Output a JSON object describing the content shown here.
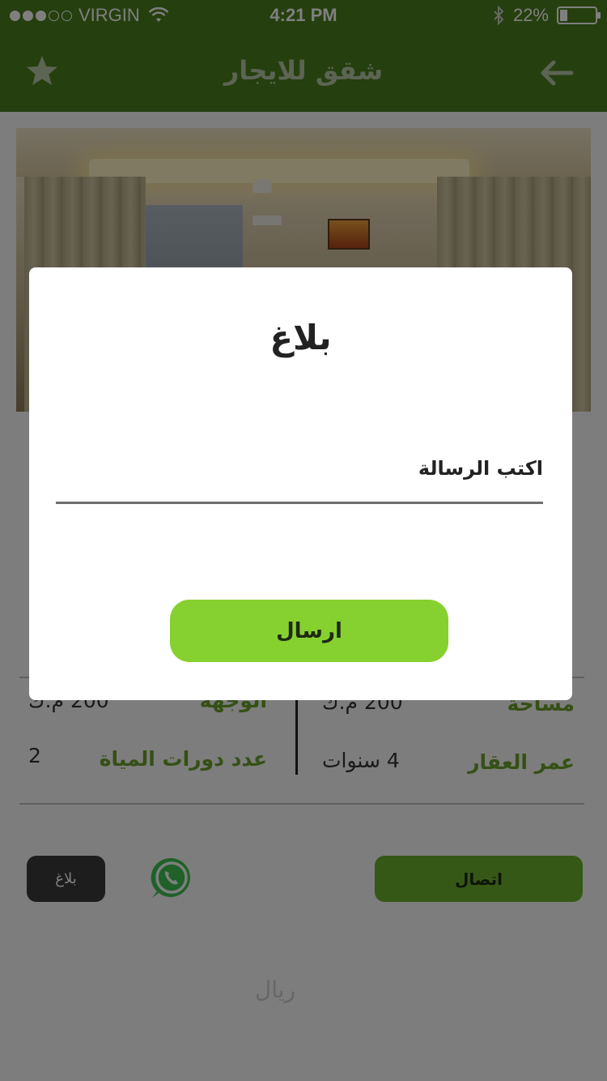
{
  "status_bar": {
    "carrier": "VIRGIN",
    "signal_bars_full": 3,
    "signal_bars_total": 5,
    "time": "4:21 PM",
    "battery_percent": "22%",
    "battery_level": 0.22
  },
  "nav": {
    "title": "شقق للايجار",
    "favorite_icon": "star-icon",
    "back_icon": "arrow-left-icon"
  },
  "colors": {
    "brand_green": "#4a7f1d",
    "label_green": "#6aa02a",
    "send_button": "#86d12f",
    "call_button": "#6bb02e"
  },
  "details": {
    "left_rows": [
      {
        "label": "الوجهة",
        "value": "200  م.ك"
      },
      {
        "label": "عدد دورات المياة",
        "value": "2"
      }
    ],
    "right_rows": [
      {
        "label": "مساحة",
        "value": "200  م.ك"
      },
      {
        "label": "عمر العقار",
        "value": "4  سنوات"
      }
    ]
  },
  "actions": {
    "call_label": "اتصال",
    "report_label": "بلاغ",
    "whatsapp_icon": "whatsapp-icon"
  },
  "footer_text": "ريال",
  "dialog": {
    "title": "بلاغ",
    "message_placeholder": "اكتب الرسالة",
    "send_label": "ارسال"
  }
}
